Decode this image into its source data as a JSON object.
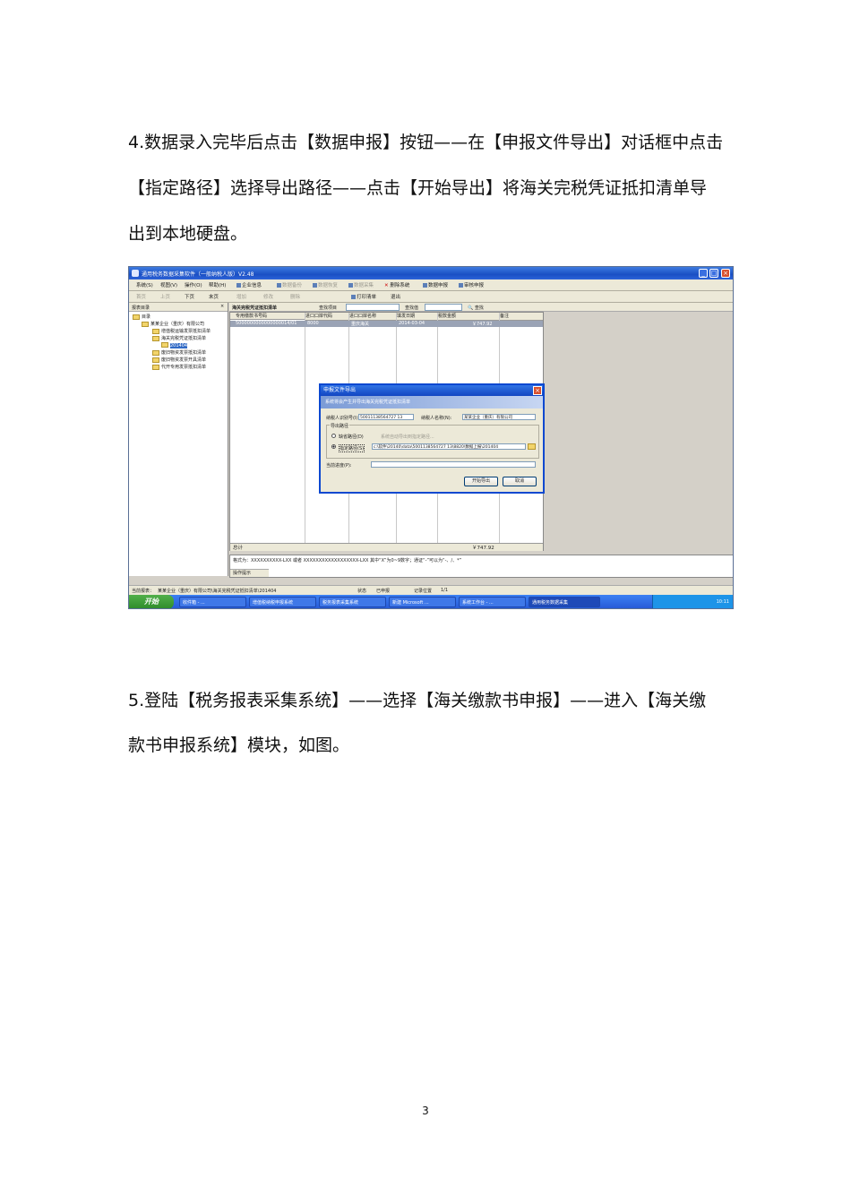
{
  "paragraphs": {
    "p4_line1": "4.数据录入完毕后点击【数据申报】按钮——在【申报文件导出】对话框中点击",
    "p4_line2": "【指定路径】选择导出路径——点击【开始导出】将海关完税凭证抵扣清单导",
    "p4_line3": "出到本地硬盘。",
    "p5_line1": "5.登陆【税务报表采集系统】——选择【海关缴款书申报】——进入【海关缴",
    "p5_line2": "款书申报系统】模块，如图。"
  },
  "page_number": "3",
  "screenshot": {
    "window_title": "通用税务数据采集软件（一般纳税人版）V2.48",
    "menu": [
      "系统(S)",
      "视图(V)",
      "操作(O)",
      "帮助(H)",
      "企业信息",
      "数据备份",
      "数据恢复",
      "数据采集",
      "删除系统",
      "数据申报",
      "审核申报"
    ],
    "toolbar": [
      "首页",
      "上页",
      "下页",
      "末页",
      "增加",
      "修改",
      "删除",
      "打印清单",
      "退出"
    ],
    "left_header": "报表目录",
    "grid_header_title": "海关完税凭证抵扣清单",
    "search_labels": [
      "查找项目",
      "查找值",
      "查找"
    ],
    "tree": [
      "目录",
      "某某企业（重庆）有限公司",
      "增值税运输发票抵扣清单",
      "海关完税凭证抵扣清单",
      "201404",
      "废旧物资发票抵扣清单",
      "废旧物资发票开具清单",
      "代开专用发票抵扣清单"
    ],
    "grid_columns": [
      "专用缴款书号码",
      "进口口岸代码",
      "进口口岸名称",
      "填发日期",
      "税款金额",
      "备注"
    ],
    "grid_row": [
      "5000000000000000014/01",
      "8000",
      "重庆海关",
      "2014-03-04",
      "￥747.92",
      ""
    ],
    "total_label": "总计",
    "total_value": "￥747.92",
    "hint": "格式为：XXXXXXXXXX-LXX 或者 XXXXXXXXXXXXXXXXXX-LXX  其中“X”为0~9数字；通证“-”可以为“-、/、*”",
    "status": [
      "当前报表：",
      "某某企业（重庆）有限公司\\海关完税凭证抵扣清单\\201404",
      "状态",
      "已申报",
      "记录位置",
      "1/1"
    ],
    "panel_tab": "操作提示",
    "taskbar": {
      "start": "开始",
      "tasks": [
        "收件箱 - ...",
        "增值税纳税申报系统",
        "税务报表采集系统",
        "新建 Microsoft ...",
        "系统工作台 - ...",
        "通用税务数据采集"
      ],
      "clock": "10:11"
    },
    "dialog": {
      "title": "申报文件导出",
      "banner": "系统将会产生并导出海关完税凭证抵扣清单",
      "taxpayer_id_label": "纳税人识别号(I):",
      "taxpayer_id": "50011138564727 13",
      "taxpayer_name_label": "纳税人名称(N):",
      "taxpayer_name": "某某企业（重庆）有限公司",
      "export_path_group": "导出路径",
      "option_default": "缺省路径(D)",
      "option_default_desc": "系统自动导出到指定路径...",
      "option_custom": "指定路径(S)",
      "path_value": "c:\\软件\\20140\\data\\5001138564727 13\\8820\\数据上报\\201404",
      "progress_label": "当前进度(P):",
      "start_button": "开始导出",
      "cancel_button": "取消"
    }
  }
}
